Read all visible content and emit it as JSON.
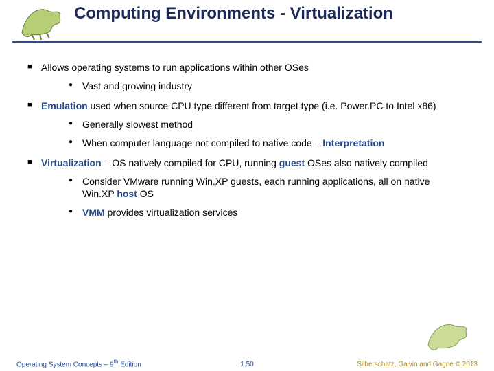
{
  "title": "Computing Environments - Virtualization",
  "bullets": {
    "b1": "Allows operating systems to run applications within other OSes",
    "b1a": "Vast and growing industry",
    "b2_term": "Emulation",
    "b2_rest": " used when source CPU type different from target type (i.e. Power.PC to Intel x86)",
    "b2a": "Generally slowest method",
    "b2b_pre": "When computer language not compiled to native code – ",
    "b2b_term": "Interpretation",
    "b3_term": "Virtualization",
    "b3_mid": " – OS natively compiled for CPU, running ",
    "b3_guest": "guest",
    "b3_rest": " OSes also natively compiled",
    "b3a_pre": "Consider VMware running Win.XP guests, each running applications, all on native Win.XP ",
    "b3a_host": "host",
    "b3a_post": " OS",
    "b3b_term": "VMM",
    "b3b_rest": " provides virtualization services"
  },
  "footer": {
    "left_pre": "Operating System Concepts – 9",
    "left_sup": "th",
    "left_post": " Edition",
    "center": "1.50",
    "right": "Silberschatz, Galvin and Gagne © 2013"
  },
  "icons": {
    "dino_tl": "dinosaur-icon",
    "dino_br": "dinosaur-icon"
  }
}
